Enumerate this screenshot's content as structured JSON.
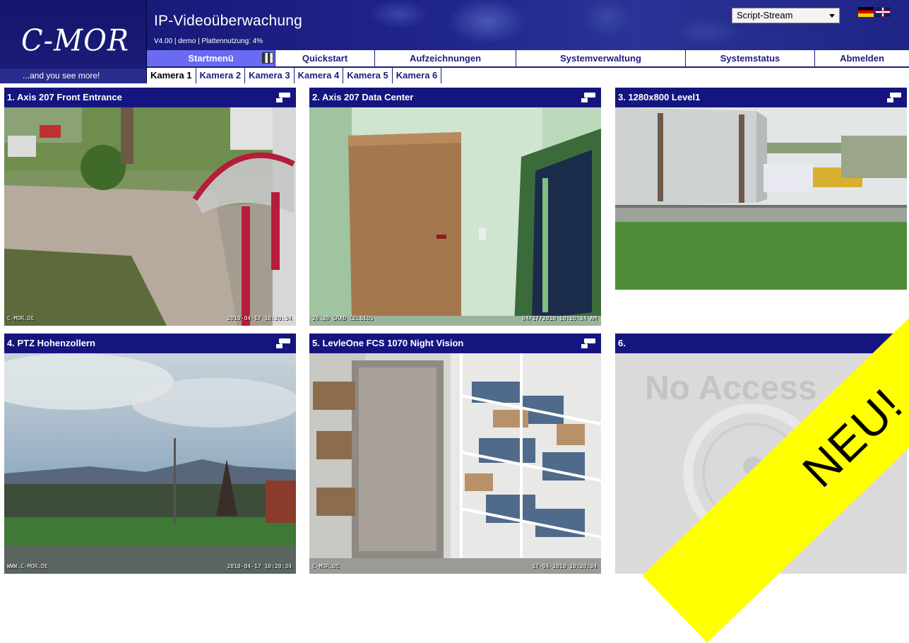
{
  "header": {
    "logo": "C-MOR",
    "slogan": "...and you see more!",
    "title": "IP-Videoüberwachung",
    "subtitle": "V4.00 | demo | Plattennutzung: 4%",
    "stream_select": "Script-Stream",
    "flags": [
      "flag-de",
      "flag-gb"
    ]
  },
  "menu": [
    {
      "label": "Startmenü",
      "active": true
    },
    {
      "label": "Quickstart",
      "active": false
    },
    {
      "label": "Aufzeichnungen",
      "active": false
    },
    {
      "label": "Systemverwaltung",
      "active": false
    },
    {
      "label": "Systemstatus",
      "active": false
    },
    {
      "label": "Abmelden",
      "active": false
    }
  ],
  "camera_tabs": [
    "Kamera 1",
    "Kamera 2",
    "Kamera 3",
    "Kamera 4",
    "Kamera 5",
    "Kamera 6"
  ],
  "tiles": [
    {
      "title": "1. Axis 207 Front Entrance",
      "overlay_left": "C-MOR.DE",
      "overlay_right": "2010-04-17 10:20:34"
    },
    {
      "title": "2. Axis 207 Data Center",
      "overlay_left": "26.30 GRAD CELSIUS",
      "overlay_right": "04/17/2010 10:20:34 AM"
    },
    {
      "title": "3. 1280x800 Level1",
      "overlay_left": "",
      "overlay_right": ""
    },
    {
      "title": "4. PTZ Hohenzollern",
      "overlay_left": "WWW.C-MOR.DE",
      "overlay_right": "2010-04-17 10:20:34"
    },
    {
      "title": "5. LevleOne FCS 1070 Night Vision",
      "overlay_left": "C-MOR.DE",
      "overlay_right": "17-04-2010 10:20:34"
    },
    {
      "title": "6.",
      "overlay_left": "",
      "overlay_right": ""
    }
  ],
  "no_access": "No Access",
  "banner": "NEU!",
  "colors": {
    "header_bg": "#1d1d80",
    "menu_active": "#6a6af2",
    "banner": "#ffff00"
  }
}
